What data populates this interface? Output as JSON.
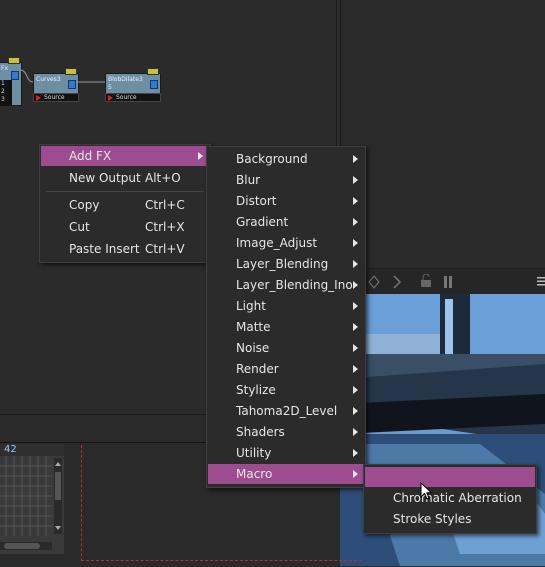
{
  "node_editor": {
    "nodes": [
      {
        "label": "Fx",
        "inputs": [
          "1",
          "2",
          "3"
        ]
      },
      {
        "label": "Curves3",
        "source": "Source"
      },
      {
        "label": "BlobDilate3",
        "source": "Source"
      }
    ],
    "node_input_badge": "5"
  },
  "context_menu": {
    "items": [
      {
        "label": "Add FX",
        "shortcut": ""
      },
      {
        "label": "New Output",
        "shortcut": "Alt+O"
      },
      {
        "label": "Copy",
        "shortcut": "Ctrl+C"
      },
      {
        "label": "Cut",
        "shortcut": "Ctrl+X"
      },
      {
        "label": "Paste Insert",
        "shortcut": "Ctrl+V"
      }
    ]
  },
  "add_fx_menu": {
    "items": [
      "Background",
      "Blur",
      "Distort",
      "Gradient",
      "Image_Adjust",
      "Layer_Blending",
      "Layer_Blending_Ino",
      "Light",
      "Matte",
      "Noise",
      "Render",
      "Stylize",
      "Tahoma2D_Level",
      "Shaders",
      "Utility",
      "Macro"
    ]
  },
  "macro_menu": {
    "items": [
      "",
      "Chromatic Aberration",
      "Stroke Styles"
    ]
  },
  "xsheet": {
    "frame_number": "42"
  },
  "colors": {
    "highlight": "#9e4c90",
    "menu_bg": "#2b2b2b",
    "node_fill": "#6d8fa3"
  }
}
